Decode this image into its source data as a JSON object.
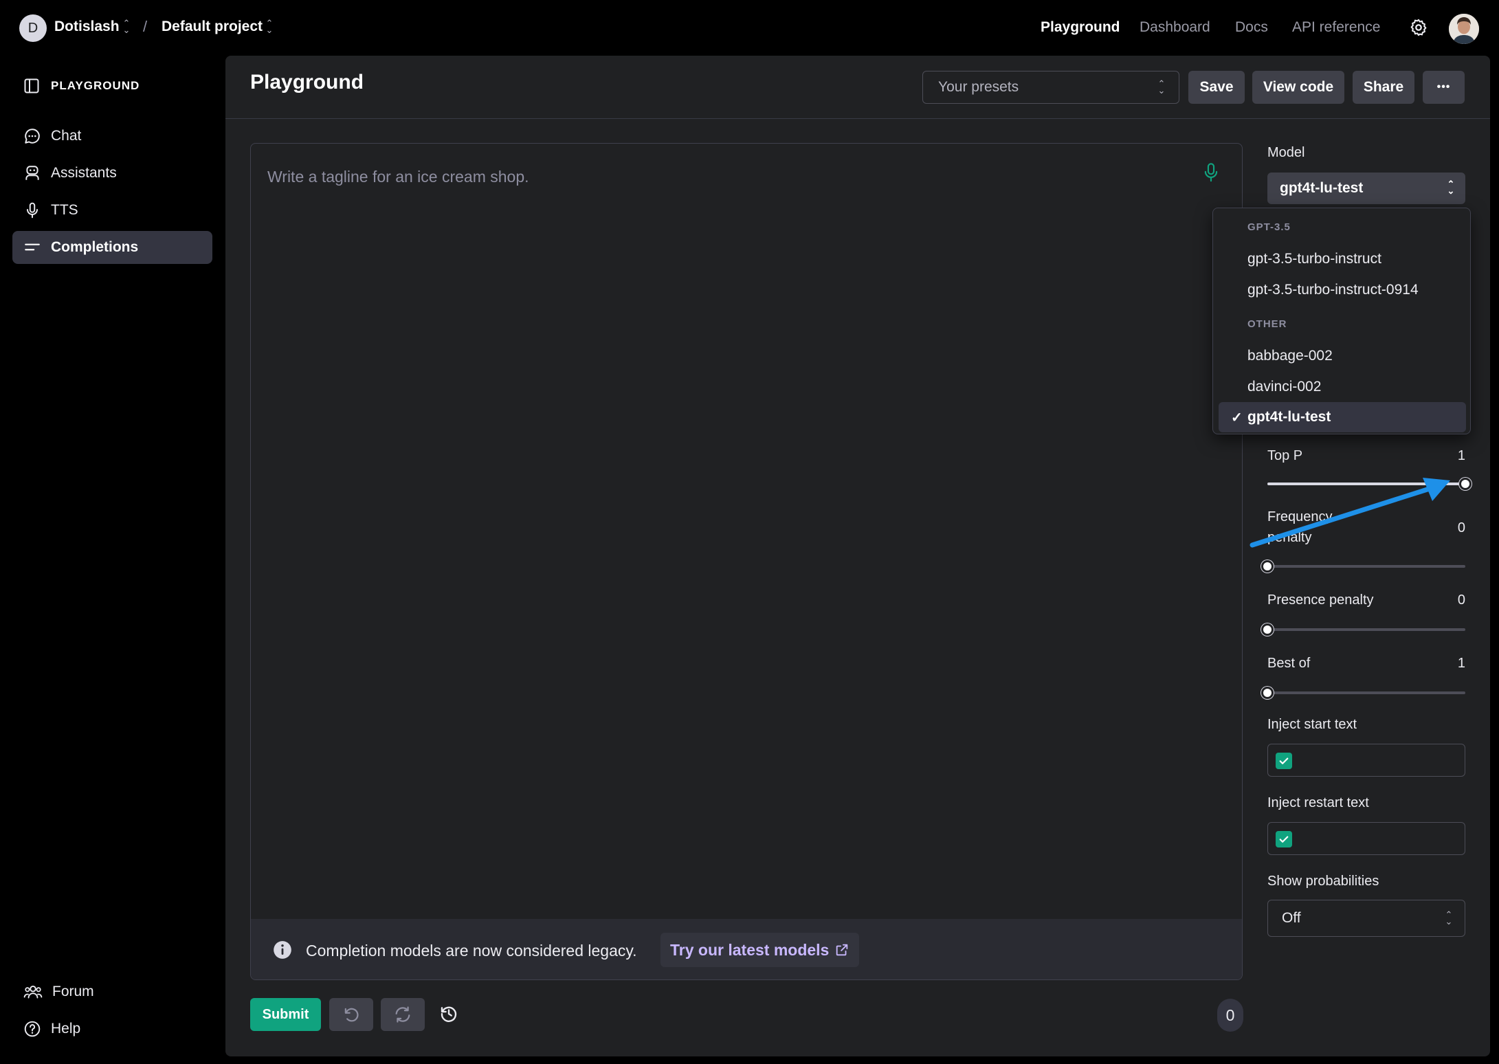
{
  "topbar": {
    "org_initial": "D",
    "org_name": "Dotislash",
    "separator": "/",
    "project_name": "Default project",
    "nav": [
      "Playground",
      "Dashboard",
      "Docs",
      "API reference"
    ],
    "active_nav": "Playground",
    "icons": [
      "chevron-up-down-icon",
      "gear-icon",
      "user-avatar"
    ]
  },
  "sidebar": {
    "heading": "PLAYGROUND",
    "items": [
      {
        "label": "Chat",
        "icon": "chat-bubble-icon"
      },
      {
        "label": "Assistants",
        "icon": "robot-icon"
      },
      {
        "label": "TTS",
        "icon": "microphone-icon"
      },
      {
        "label": "Completions",
        "icon": "lines-icon",
        "active": true
      }
    ],
    "bottom_items": [
      {
        "label": "Forum",
        "icon": "people-icon"
      },
      {
        "label": "Help",
        "icon": "help-circle-icon"
      }
    ]
  },
  "header": {
    "title": "Playground",
    "presets_placeholder": "Your presets",
    "save_label": "Save",
    "view_code_label": "View code",
    "share_label": "Share",
    "more_label": "•••"
  },
  "editor": {
    "placeholder": "Write a tagline for an ice cream shop.",
    "legacy_notice": "Completion models are now considered legacy.",
    "latest_link": "Try our latest models"
  },
  "footer": {
    "submit_label": "Submit",
    "token_count": "0"
  },
  "settings": {
    "model_label": "Model",
    "model_value": "gpt4t-lu-test",
    "top_p": {
      "label": "Top P",
      "value": "1",
      "fraction": 1.0
    },
    "frequency_penalty": {
      "label_line1": "Frequency",
      "label_line2": "penalty",
      "value": "0",
      "fraction": 0.0
    },
    "presence_penalty": {
      "label": "Presence penalty",
      "value": "0",
      "fraction": 0.0
    },
    "best_of": {
      "label": "Best of",
      "value": "1",
      "fraction": 0.0
    },
    "inject_start": {
      "label": "Inject start text",
      "checked": true
    },
    "inject_restart": {
      "label": "Inject restart text",
      "checked": true
    },
    "show_probabilities": {
      "label": "Show probabilities",
      "value": "Off"
    }
  },
  "model_dropdown": {
    "groups": [
      {
        "name": "GPT-3.5",
        "items": [
          "gpt-3.5-turbo-instruct",
          "gpt-3.5-turbo-instruct-0914"
        ]
      },
      {
        "name": "OTHER",
        "items": [
          "babbage-002",
          "davinci-002",
          "gpt4t-lu-test"
        ]
      }
    ],
    "selected": "gpt4t-lu-test",
    "check_mark": "✓"
  },
  "colors": {
    "accent_green": "#10a37f",
    "panel_bg": "#202123",
    "page_bg": "#000000",
    "annotation_arrow": "#1e90e8",
    "link_purple": "#c9b8ff"
  }
}
